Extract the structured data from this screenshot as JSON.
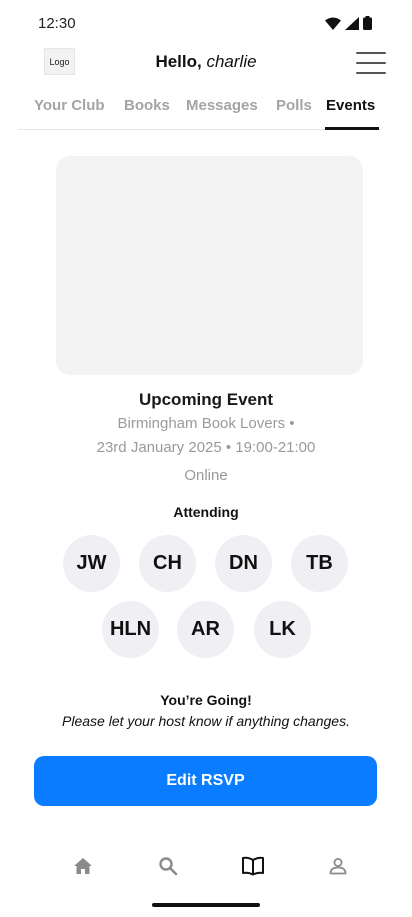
{
  "status_bar": {
    "time": "12:30",
    "icons": [
      "wifi-icon",
      "signal-icon",
      "battery-icon"
    ]
  },
  "header": {
    "logo_text": "Logo",
    "greeting_prefix": "Hello,",
    "user_name": "charlie",
    "menu_icon": "hamburger-menu-icon"
  },
  "tabs": [
    {
      "label": "Your  Club",
      "active": false
    },
    {
      "label": "Books",
      "active": false
    },
    {
      "label": "Messages",
      "active": false
    },
    {
      "label": "Polls",
      "active": false
    },
    {
      "label": "Events",
      "active": true
    }
  ],
  "event": {
    "heading": "Upcoming Event",
    "club_line": "Birmingham Book Lovers •",
    "date_line": "23rd January 2025  •  19:00-21:00",
    "mode": "Online"
  },
  "attending": {
    "label": "Attending",
    "attendees": [
      "JW",
      "CH",
      "DN",
      "TB",
      "HLN",
      "AR",
      "LK"
    ]
  },
  "rsvp": {
    "status_title": "You’re Going!",
    "note": "Please let your host know if anything changes.",
    "button_label": "Edit RSVP"
  },
  "bottom_nav": [
    {
      "icon": "home-icon",
      "active": false
    },
    {
      "icon": "search-icon",
      "active": false
    },
    {
      "icon": "book-icon",
      "active": true
    },
    {
      "icon": "profile-icon",
      "active": false
    }
  ],
  "colors": {
    "primary_button": "#0a7cff",
    "active_tab": "#111111",
    "inactive_tab": "#a4a4a4",
    "avatar_background": "#f0f0f4"
  }
}
